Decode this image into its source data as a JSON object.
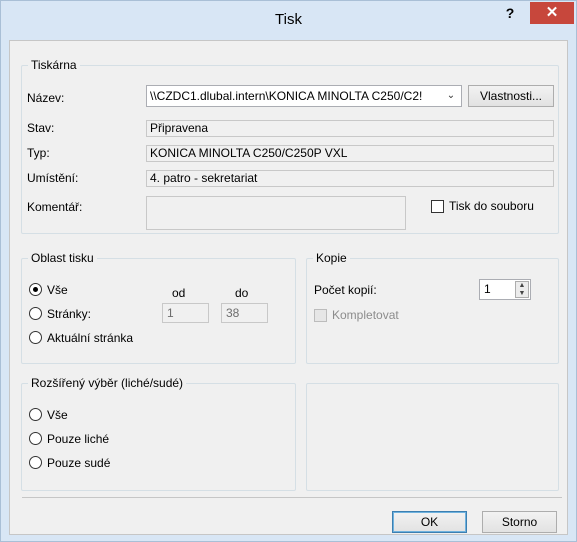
{
  "window": {
    "title": "Tisk",
    "help": "?",
    "close": "✕"
  },
  "printer": {
    "group_label": "Tiskárna",
    "name_label": "Název:",
    "name_value": "\\\\CZDC1.dlubal.intern\\KONICA MINOLTA C250/C2!",
    "properties_button": "Vlastnosti...",
    "status_label": "Stav:",
    "status_value": "Připravena",
    "type_label": "Typ:",
    "type_value": "KONICA MINOLTA C250/C250P VXL",
    "location_label": "Umístění:",
    "location_value": "4. patro - sekretariat",
    "comment_label": "Komentář:",
    "print_to_file_label": "Tisk do souboru"
  },
  "print_range": {
    "group_label": "Oblast tisku",
    "all_label": "Vše",
    "pages_label": "Stránky:",
    "current_page_label": "Aktuální stránka",
    "from_label": "od",
    "to_label": "do",
    "from_value": "1",
    "to_value": "38",
    "selected": "all"
  },
  "copies": {
    "group_label": "Kopie",
    "count_label": "Počet kopií:",
    "count_value": "1",
    "collate_label": "Kompletovat"
  },
  "extended": {
    "group_label": "Rozšířený výběr (liché/sudé)",
    "all_label": "Vše",
    "odd_label": "Pouze liché",
    "even_label": "Pouze sudé"
  },
  "footer": {
    "ok_label": "OK",
    "cancel_label": "Storno"
  }
}
